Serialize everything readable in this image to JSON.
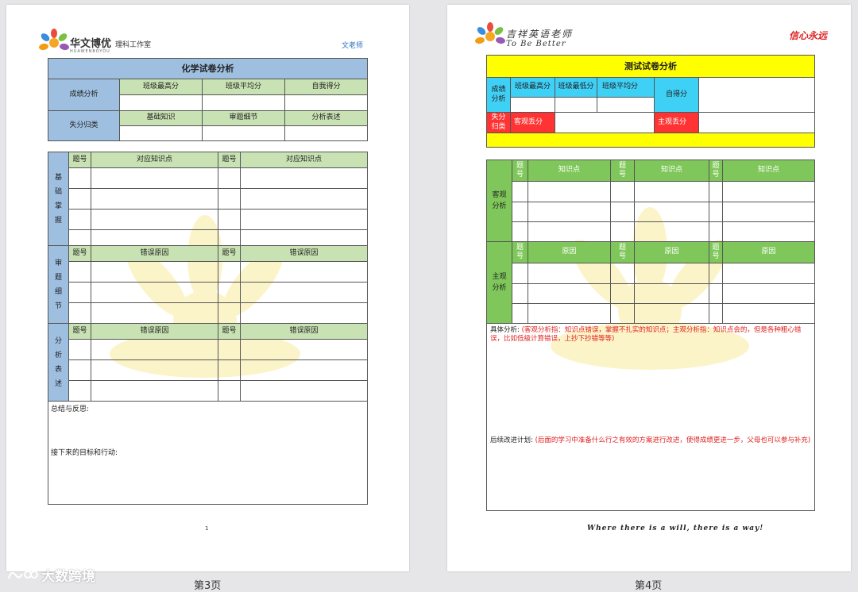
{
  "left_page": {
    "brand": "华文博优",
    "brand_sub": "HUAWENBOYOU",
    "studio": "理科工作室",
    "teacher": "文老师",
    "title": "化学试卷分析",
    "score": {
      "label": "成绩分析",
      "cols": [
        "班级最高分",
        "班级平均分",
        "自我得分"
      ]
    },
    "loss": {
      "label": "失分归类",
      "cols": [
        "基础知识",
        "审题细节",
        "分析表述"
      ]
    },
    "sections": [
      {
        "label": "基础掌握",
        "h1": "题号",
        "h2": "对应知识点",
        "h3": "题号",
        "h4": "对应知识点"
      },
      {
        "label": "审题细节",
        "h1": "题号",
        "h2": "错误原因",
        "h3": "题号",
        "h4": "错误原因"
      },
      {
        "label": "分析表述",
        "h1": "题号",
        "h2": "错误原因",
        "h3": "题号",
        "h4": "错误原因"
      }
    ],
    "summary": "总结与反思:",
    "next": "接下来的目标和行动:",
    "page_num": "1",
    "caption": "第3页"
  },
  "right_page": {
    "brand": "吉祥英语老师",
    "slogan": "To  Be  Better",
    "logo_text": "信心永远",
    "title": "测试试卷分析",
    "score_label": "成绩分析",
    "score_cols": [
      "班级最高分",
      "班级最低分",
      "班级平均分"
    ],
    "self_score": "自得分",
    "loss_label": "失分归类",
    "objective": "客观丢分",
    "subjective": "主观丢分",
    "obj_section": {
      "label": "客观分析",
      "num": "题号",
      "col": "知识点"
    },
    "sub_section": {
      "label": "主观分析",
      "num": "题号",
      "col": "原因"
    },
    "detail_label": "具体分析:",
    "detail_text": "(客观分析指：知识点错误，掌握不扎实的知识点；主观分析指：知识点会的，但是各种粗心错误，比如低级计算错误，上抄下抄错等等)",
    "plan_label": "后续改进计划:",
    "plan_text": "(后面的学习中准备什么行之有效的方案进行改进，使得成绩更进一步，父母也可以参与补充)",
    "motto": "Where there is a will, there is a way!",
    "caption": "第4页"
  },
  "watermark": "大数跨境",
  "colors": {
    "blue_header": "#9fbfe0",
    "green_header": "#c8e2b3",
    "green_dark": "#7fc75a",
    "yellow": "#ffff00",
    "cyan": "#3fd0f6",
    "red": "#ff3333",
    "red_text": "#e02020"
  }
}
